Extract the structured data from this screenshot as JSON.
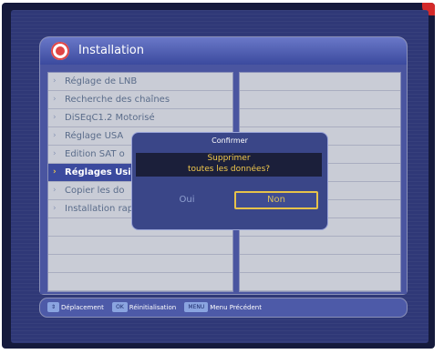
{
  "title_bar": {
    "title": "Installation",
    "icon": "satellite-logo-icon"
  },
  "menu": {
    "items": [
      {
        "label": "Réglage de LNB",
        "selected": false
      },
      {
        "label": "Recherche des chaînes",
        "selected": false
      },
      {
        "label": "DiSEqC1.2 Motorisé",
        "selected": false
      },
      {
        "label": "Réglage USA",
        "selected": false
      },
      {
        "label": "Edition SAT o",
        "selected": false
      },
      {
        "label": "Réglages Usi",
        "selected": true
      },
      {
        "label": "Copier les do",
        "selected": false
      },
      {
        "label": "Installation rapide",
        "selected": false
      }
    ]
  },
  "dialog": {
    "title": "Confirmer",
    "message_line1": "Supprimer",
    "message_line2": "toutes les données?",
    "yes_label": "Oui",
    "no_label": "Non"
  },
  "footer": {
    "keys": [
      {
        "key": "⇕",
        "label": "Déplacement"
      },
      {
        "key": "OK",
        "label": "Réinitialisation"
      },
      {
        "key": "MENU",
        "label": "Menu Précédent"
      }
    ]
  },
  "colors": {
    "background": "#2f3877",
    "panel": "#c9ccd6",
    "accent": "#f2c94c",
    "selected_row": "#3b4a9e"
  }
}
